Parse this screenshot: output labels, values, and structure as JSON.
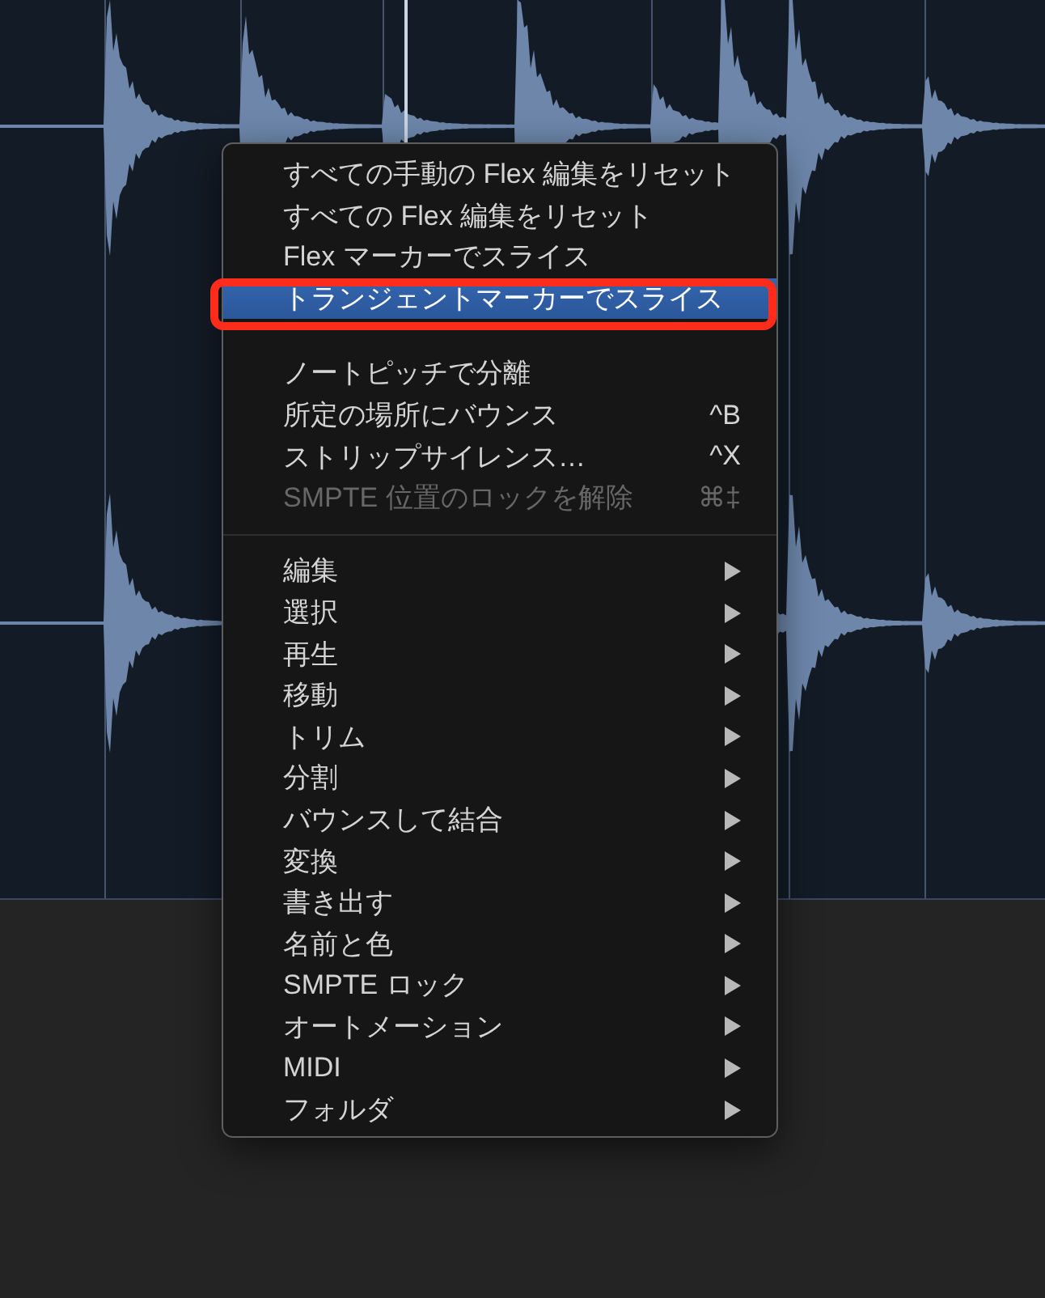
{
  "menu": {
    "sections": [
      {
        "divider_above": false,
        "items": [
          {
            "label": "すべての手動の Flex 編集をリセット",
            "disabled": false,
            "selected": false,
            "outlined": false,
            "submenu": false
          },
          {
            "label": "すべての Flex 編集をリセット",
            "disabled": false,
            "selected": false,
            "outlined": false,
            "submenu": false
          },
          {
            "label": "Flex マーカーでスライス",
            "disabled": false,
            "selected": false,
            "outlined": false,
            "submenu": false
          },
          {
            "label": "トランジェントマーカーでスライス",
            "disabled": false,
            "selected": true,
            "outlined": true,
            "submenu": false
          }
        ]
      },
      {
        "divider_above": false,
        "items": [
          {
            "label": "ノートピッチで分離",
            "disabled": false,
            "selected": false,
            "outlined": false,
            "submenu": false
          },
          {
            "label": "所定の場所にバウンス",
            "shortcut": "^B",
            "disabled": false,
            "selected": false,
            "outlined": false,
            "submenu": false
          },
          {
            "label": "ストリップサイレンス…",
            "shortcut": "^X",
            "disabled": false,
            "selected": false,
            "outlined": false,
            "submenu": false
          },
          {
            "label": "SMPTE 位置のロックを解除",
            "shortcut": "⌘‡",
            "disabled": true,
            "selected": false,
            "outlined": false,
            "submenu": false
          }
        ]
      },
      {
        "divider_above": true,
        "items": [
          {
            "label": "編集",
            "disabled": false,
            "selected": false,
            "outlined": false,
            "submenu": true
          },
          {
            "label": "選択",
            "disabled": false,
            "selected": false,
            "outlined": false,
            "submenu": true
          },
          {
            "label": "再生",
            "disabled": false,
            "selected": false,
            "outlined": false,
            "submenu": true
          },
          {
            "label": "移動",
            "disabled": false,
            "selected": false,
            "outlined": false,
            "submenu": true
          },
          {
            "label": "トリム",
            "disabled": false,
            "selected": false,
            "outlined": false,
            "submenu": true
          },
          {
            "label": "分割",
            "disabled": false,
            "selected": false,
            "outlined": false,
            "submenu": true
          },
          {
            "label": "バウンスして結合",
            "disabled": false,
            "selected": false,
            "outlined": false,
            "submenu": true
          },
          {
            "label": "変換",
            "disabled": false,
            "selected": false,
            "outlined": false,
            "submenu": true
          },
          {
            "label": "書き出す",
            "disabled": false,
            "selected": false,
            "outlined": false,
            "submenu": true
          },
          {
            "label": "名前と色",
            "disabled": false,
            "selected": false,
            "outlined": false,
            "submenu": true
          },
          {
            "label": "SMPTE ロック",
            "disabled": false,
            "selected": false,
            "outlined": false,
            "submenu": true
          },
          {
            "label": "オートメーション",
            "disabled": false,
            "selected": false,
            "outlined": false,
            "submenu": true
          },
          {
            "label": "MIDI",
            "disabled": false,
            "selected": false,
            "outlined": false,
            "submenu": true
          },
          {
            "label": "フォルダ",
            "disabled": false,
            "selected": false,
            "outlined": false,
            "submenu": true
          }
        ]
      }
    ]
  }
}
